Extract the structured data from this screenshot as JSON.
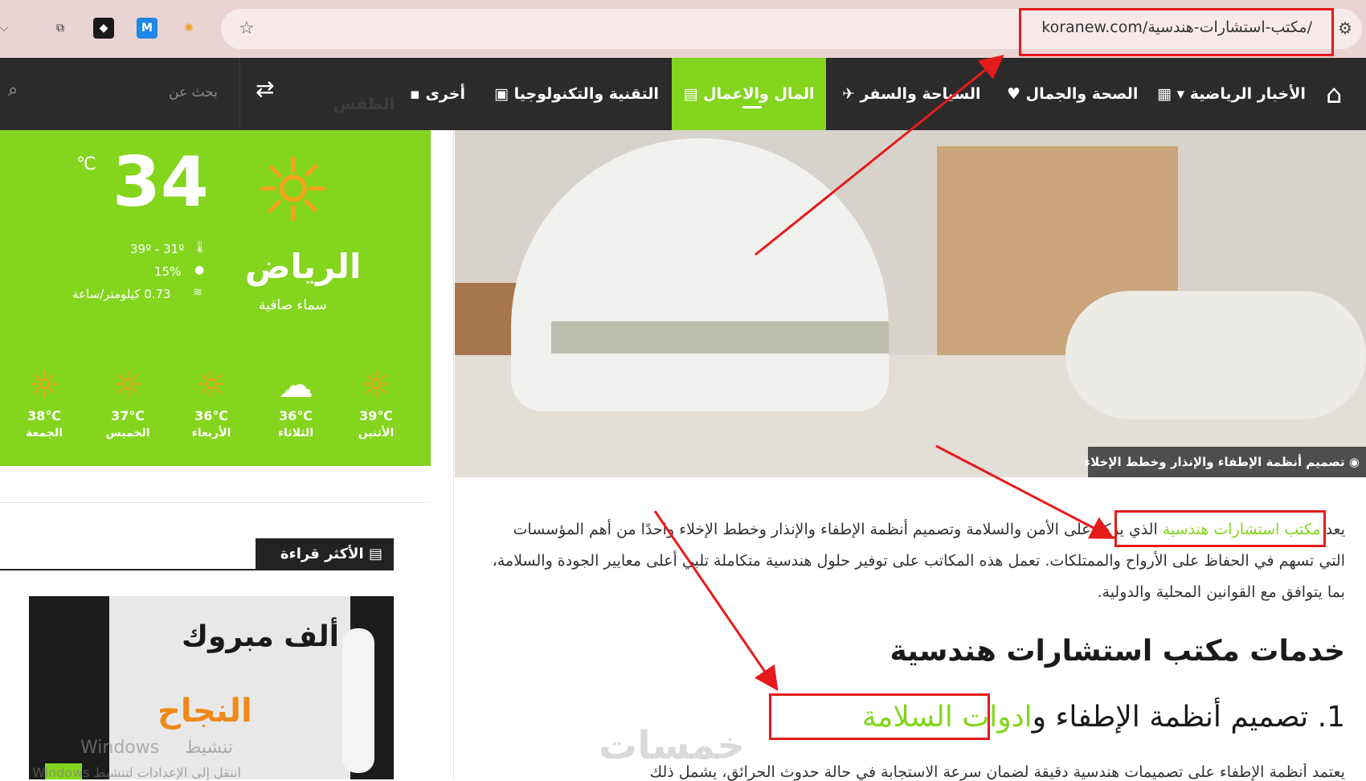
{
  "browser": {
    "url": "koranew.com/مكتب-استشارات-هندسية/",
    "star_icon": "☆",
    "tune_icon": "⚙"
  },
  "nav": {
    "home_icon": "⌂",
    "items": [
      {
        "label": "الأخبار الرياضية ▾"
      },
      {
        "label": "الصحة والجمال"
      },
      {
        "label": "السياحة والسفر"
      },
      {
        "label": "المال والاعمال"
      },
      {
        "label": "التقنية والتكنولوجيا"
      },
      {
        "label": "أخرى"
      }
    ],
    "search_placeholder": "بحث عن",
    "faded_text": "الطقس"
  },
  "weather": {
    "temp": "34",
    "unit": "℃",
    "city": "الرياض",
    "condition": "سماء صافية",
    "range": "39º - 31º",
    "humidity": "15%",
    "wind": "0.73 كيلومتر/ساعة",
    "forecast": [
      {
        "temp": "39℃",
        "day": "الأثنين"
      },
      {
        "temp": "36℃",
        "day": "الثلاثاء"
      },
      {
        "temp": "36℃",
        "day": "الأربعاء"
      },
      {
        "temp": "37℃",
        "day": "الخميس"
      },
      {
        "temp": "38℃",
        "day": "الجمعة"
      }
    ]
  },
  "sidebar": {
    "most_read": "الأكثر قراءة",
    "thumb_title1": "ألف مبروك",
    "thumb_title2": "النجاح"
  },
  "watermark": {
    "line1a": "Windows",
    "line1b": "تنشيط",
    "line2": "انتقل إلى الإعدادات لتنشيط Windows",
    "logo": "خمسات"
  },
  "hero": {
    "caption": "تصميم أنظمة الإطفاء والإنذار وخطط الإخلاء"
  },
  "article": {
    "p1_start": "يعد",
    "p1_link": "مكتب استشارات هندسية",
    "p1_rest": "الذي يركز على الأمن والسلامة وتصميم أنظمة الإطفاء والإنذار وخطط الإخلاء واحدًا من أهم المؤسسات التي تسهم في الحفاظ على الأرواح والممتلكات. تعمل هذه المكاتب على توفير حلول هندسية متكاملة تلبي أعلى معايير الجودة والسلامة، بما يتوافق مع القوانين المحلية والدولية.",
    "h2": "خدمات مكتب استشارات هندسية",
    "h3_text": "1. تصميم أنظمة الإطفاء و",
    "h3_link": "ادوات السلامة",
    "p2": "يعتمد أنظمة الإطفاء على تصميمات هندسية دقيقة لضمان سرعة الاستجابة في حالة حدوث الحرائق، يشمل ذلك"
  }
}
